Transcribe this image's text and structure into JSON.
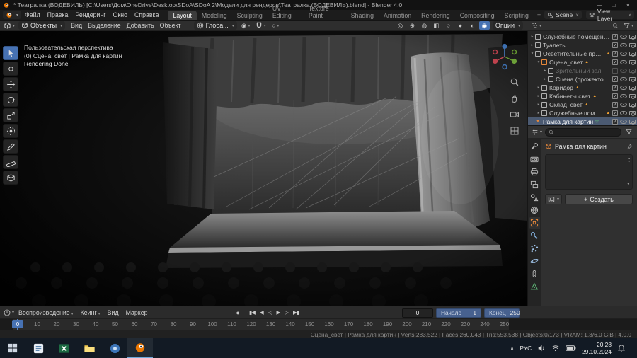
{
  "titlebar": {
    "title": "* Театралка (ВОДЕВИЛЬ) [C:\\Users\\Дом\\OneDrive\\Desktop\\SDoA\\SDoA 2\\Модели для рендеров\\Театралка (ВОДЕВИЛЬ).blend] - Blender 4.0"
  },
  "menubar": {
    "menus": [
      "Файл",
      "Правка",
      "Рендеринг",
      "Окно",
      "Справка"
    ],
    "workspaces": [
      "Layout",
      "Modeling",
      "Sculpting",
      "UV Editing",
      "Texture Paint",
      "Shading",
      "Animation",
      "Rendering",
      "Compositing",
      "Scripting"
    ],
    "active_workspace": "Layout",
    "add_tab": "+",
    "scene": "Scene",
    "view_layer": "View Layer"
  },
  "tool_header": {
    "mode": "Объекты",
    "menus": [
      "Вид",
      "Выделение",
      "Добавить",
      "Объект"
    ],
    "orientation": "Глоба...",
    "options": "Опции",
    "right_icons": [
      "visibility-icon",
      "gizmos-icon",
      "overlays-icon",
      "xray-icon",
      "shading-wireframe-icon",
      "shading-solid-icon",
      "shading-material-icon",
      "shading-rendered-icon"
    ],
    "active_shading": "shading-rendered-icon"
  },
  "viewport": {
    "overlay": [
      "Пользовательская перспектива",
      "(0) Сцена_свет | Рамка для картин",
      "Rendering Done"
    ],
    "tools": [
      "select-tool",
      "cursor-tool",
      "move-tool",
      "rotate-tool",
      "scale-tool",
      "transform-tool",
      "annotate-tool",
      "measure-tool",
      "add-cube-tool"
    ],
    "nav_icons": [
      "zoom-icon",
      "pan-icon",
      "camera-view-icon",
      "ortho-toggle-icon"
    ]
  },
  "outliner": {
    "rows": [
      {
        "label": "Служебные помещения",
        "indent": 0,
        "arrow": "▸",
        "icon": "collection",
        "checked": true
      },
      {
        "label": "Туалеты",
        "indent": 0,
        "arrow": "▸",
        "icon": "collection",
        "checked": true
      },
      {
        "label": "Осветительные приборы",
        "indent": 0,
        "arrow": "▾",
        "icon": "collection",
        "checked": true,
        "light": true
      },
      {
        "label": "Сцена_свет",
        "indent": 1,
        "arrow": "▾",
        "icon": "collection-orange",
        "checked": true,
        "light": true
      },
      {
        "label": "Зрительный зал",
        "indent": 2,
        "arrow": "▸",
        "icon": "collection",
        "checked": false,
        "dim": true
      },
      {
        "label": "Сцена (прожекторы)",
        "indent": 2,
        "arrow": "▸",
        "icon": "collection",
        "checked": true
      },
      {
        "label": "Коридор",
        "indent": 1,
        "arrow": "▸",
        "icon": "collection",
        "checked": true,
        "light": true
      },
      {
        "label": "Кабинеты свет",
        "indent": 1,
        "arrow": "▸",
        "icon": "collection",
        "checked": true,
        "light": true
      },
      {
        "label": "Склад_свет",
        "indent": 1,
        "arrow": "▸",
        "icon": "collection",
        "checked": true,
        "light": true
      },
      {
        "label": "Служебные помещения",
        "indent": 1,
        "arrow": "▸",
        "icon": "collection",
        "checked": true,
        "light": true
      },
      {
        "label": "Рамка для картин",
        "indent": 0,
        "arrow": "",
        "icon": "object",
        "checked": true,
        "selected": true,
        "mesh": true
      }
    ]
  },
  "properties": {
    "object_name": "Рамка для картин",
    "new_button": "Создать",
    "active_tab": "object",
    "tabs": [
      "tool",
      "render",
      "output",
      "view-layer",
      "scene",
      "world",
      "object",
      "modifiers",
      "particles",
      "physics",
      "constraints",
      "data"
    ]
  },
  "timeline": {
    "menus": [
      "Воспроизведение",
      "Кеинг",
      "Вид",
      "Маркер"
    ],
    "transport": [
      "jump-start",
      "prev-keyframe",
      "play-reverse",
      "play",
      "next-keyframe",
      "jump-end"
    ],
    "current_frame": "0",
    "start_label": "Начало",
    "start_value": "1",
    "end_label": "Конец",
    "end_value": "250",
    "ticks": [
      0,
      10,
      20,
      30,
      40,
      50,
      60,
      70,
      80,
      90,
      100,
      110,
      120,
      130,
      140,
      150,
      160,
      170,
      180,
      190,
      200,
      210,
      220,
      230,
      240,
      250
    ]
  },
  "statusbar": {
    "text": "Сцена_свет | Рамка для картин | Verts:283,522 | Faces:260,043 | Tris:553,538 | Objects:0/173 | VRAM: 1.3/6.0 GiB | 4.0.0"
  },
  "taskbar": {
    "apps": [
      "files-app",
      "excel-app",
      "folder-app",
      "settings-app",
      "blender-app"
    ],
    "active_app": "blender-app",
    "tray_expand": "∧",
    "lang": "РУС",
    "time": "20:28",
    "date": "29.10.2024"
  },
  "colors": {
    "accent": "#4772b3",
    "object_orange": "#e8883a",
    "mesh_green": "#62c07c"
  }
}
